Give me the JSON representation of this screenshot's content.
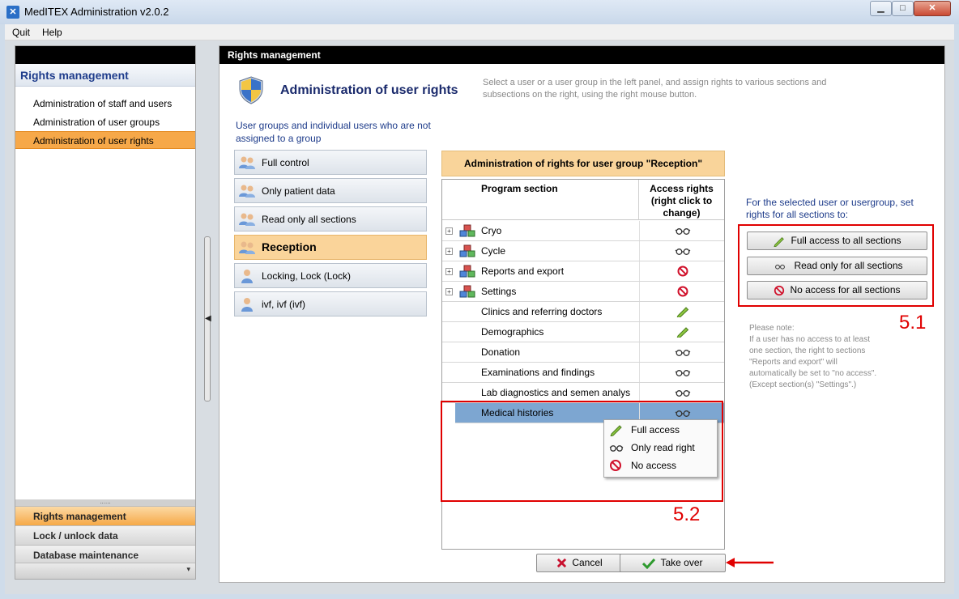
{
  "window": {
    "title": "MedITEX Administration v2.0.2",
    "min": "▁",
    "max": "□",
    "close": "✕"
  },
  "menu": {
    "quit": "Quit",
    "help": "Help"
  },
  "sidebar": {
    "heading": "Rights management",
    "items": [
      {
        "label": "Administration of staff and users"
      },
      {
        "label": "Administration of user groups"
      },
      {
        "label": "Administration of user rights"
      }
    ],
    "grip": "......",
    "nav": [
      {
        "label": "Rights management"
      },
      {
        "label": "Lock / unlock data"
      },
      {
        "label": "Database maintenance"
      }
    ],
    "dropdown": "▾"
  },
  "splitter_arrow": "◀",
  "main": {
    "header": "Rights management",
    "heading": "Administration of user rights",
    "description": "Select a user or a user group in the left panel, and assign rights to various sections and subsections on the right, using the right mouse button.",
    "groups_caption": "User groups and individual users who are not assigned to a group",
    "groups": [
      {
        "label": "Full control",
        "type": "group"
      },
      {
        "label": "Only patient data",
        "type": "group"
      },
      {
        "label": "Read only all sections",
        "type": "group"
      },
      {
        "label": "Reception",
        "type": "group"
      },
      {
        "label": "Locking, Lock  (Lock)",
        "type": "user"
      },
      {
        "label": "ivf, ivf  (ivf)",
        "type": "user"
      }
    ],
    "rights_header": "Administration of rights for user group \"Reception\"",
    "columns": {
      "section": "Program section",
      "access": "Access rights (right click to change)"
    },
    "rows": [
      {
        "name": "Cryo",
        "expandable": true,
        "access": "read"
      },
      {
        "name": "Cycle",
        "expandable": true,
        "access": "read"
      },
      {
        "name": "Reports and export",
        "expandable": true,
        "access": "none"
      },
      {
        "name": "Settings",
        "expandable": true,
        "access": "none"
      },
      {
        "name": "Clinics and referring doctors",
        "expandable": false,
        "access": "full"
      },
      {
        "name": "Demographics",
        "expandable": false,
        "access": "full"
      },
      {
        "name": "Donation",
        "expandable": false,
        "access": "read"
      },
      {
        "name": "Examinations and findings",
        "expandable": false,
        "access": "read"
      },
      {
        "name": "Lab diagnostics and semen analys",
        "expandable": false,
        "access": "read"
      },
      {
        "name": "Medical histories",
        "expandable": false,
        "access": "read"
      }
    ],
    "expander_glyph": "+",
    "context_menu": [
      {
        "label": "Full access",
        "icon": "pencil-icon"
      },
      {
        "label": "Only read right",
        "icon": "glasses-icon"
      },
      {
        "label": "No access",
        "icon": "no-entry-icon"
      }
    ],
    "set_caption": "For the selected user or usergroup, set rights for all sections to:",
    "all_buttons": {
      "full": "Full access to all sections",
      "read": "Read only for all sections",
      "none": "No access for all sections"
    },
    "note": "Please note:\nIf a user has no access to at least one section, the right to sections \"Reports and export\" will automatically be set to \"no access\". (Except section(s) \"Settings\".)",
    "cancel": "Cancel",
    "take_over": "Take over"
  },
  "annotations": {
    "label_51": "5.1",
    "label_52": "5.2"
  },
  "colors": {
    "accent_orange": "#f6a849",
    "header_peach": "#f9d49a",
    "selection_blue": "#7da6d1",
    "annotation_red": "#e00000",
    "heading_blue": "#1a2a6c"
  }
}
